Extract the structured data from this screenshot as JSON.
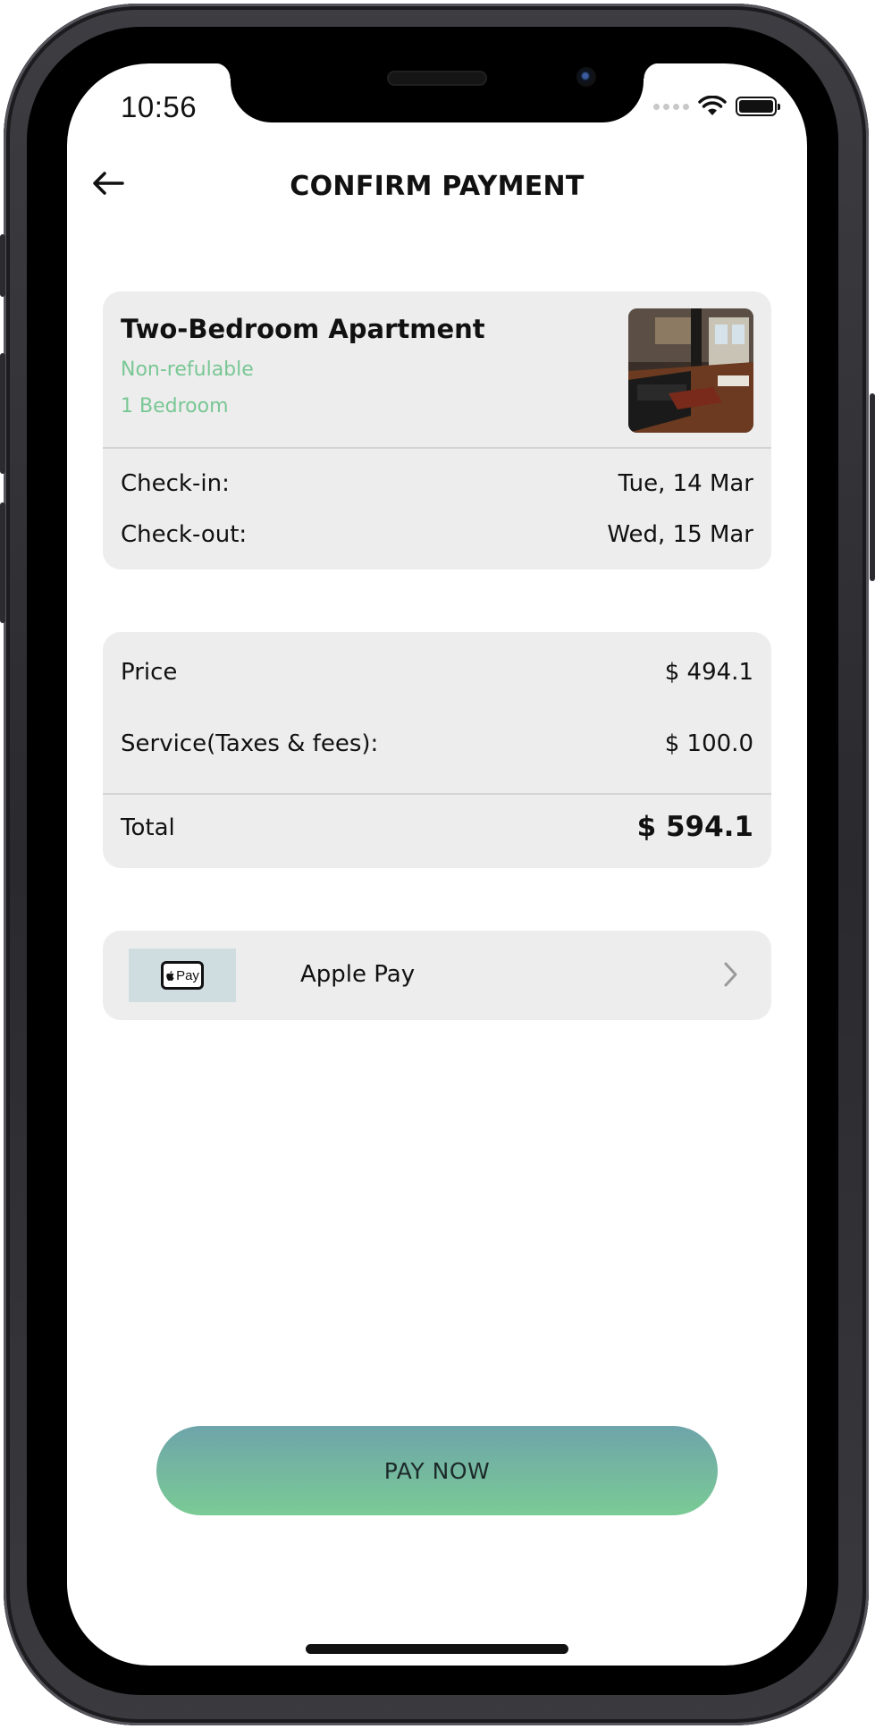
{
  "status_bar": {
    "time": "10:56"
  },
  "header": {
    "title": "CONFIRM PAYMENT",
    "back_icon": "arrow-left-icon"
  },
  "booking": {
    "title": "Two-Bedroom Apartment",
    "refund_policy": "Non-refulable",
    "bedrooms": "1 Bedroom",
    "checkin_label": "Check-in:",
    "checkin_value": "Tue, 14 Mar",
    "checkout_label": "Check-out:",
    "checkout_value": "Wed, 15 Mar"
  },
  "pricing": {
    "price_label": "Price",
    "price_value": "$ 494.1",
    "service_label": "Service(Taxes & fees):",
    "service_value": "$ 100.0",
    "total_label": "Total",
    "total_value": "$ 594.1"
  },
  "payment_method": {
    "label": "Apple Pay",
    "logo_text": "Pay",
    "icon": "apple-pay-icon"
  },
  "actions": {
    "pay_now": "PAY NOW"
  },
  "colors": {
    "accent_green": "#79c794",
    "button_top": "#6ea4aa",
    "button_bottom": "#7acb95",
    "card_bg": "#ededed"
  }
}
